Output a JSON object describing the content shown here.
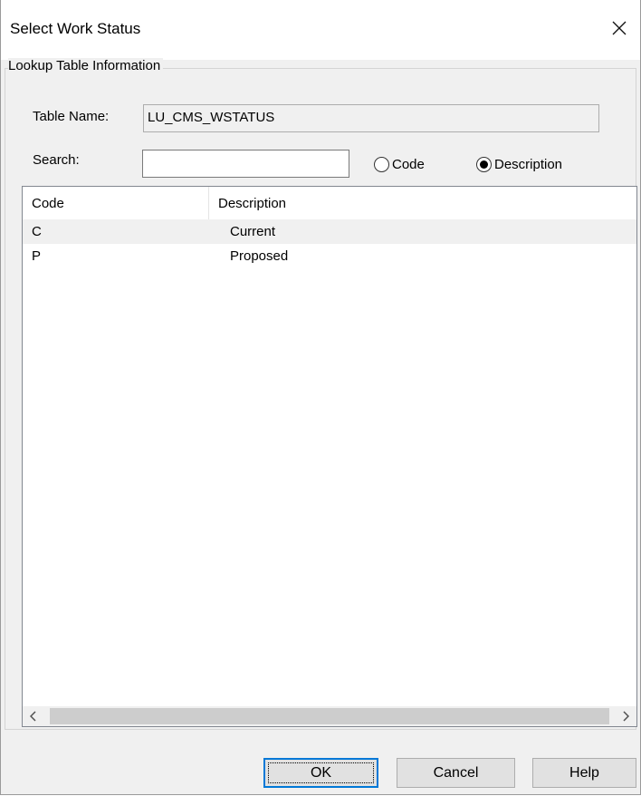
{
  "window": {
    "title": "Select Work Status"
  },
  "group": {
    "legend": "Lookup Table Information"
  },
  "table_name": {
    "label": "Table Name:",
    "value": "LU_CMS_WSTATUS"
  },
  "search": {
    "label": "Search:",
    "value": "",
    "placeholder": ""
  },
  "search_mode": {
    "options": [
      {
        "label": "Code",
        "selected": false
      },
      {
        "label": "Description",
        "selected": true
      }
    ]
  },
  "list": {
    "columns": [
      "Code",
      "Description"
    ],
    "rows": [
      {
        "code": "C",
        "description": "Current",
        "selected": true
      },
      {
        "code": "P",
        "description": "Proposed",
        "selected": false
      }
    ]
  },
  "buttons": {
    "ok": "OK",
    "cancel": "Cancel",
    "help": "Help"
  },
  "icons": {
    "close": "close-icon",
    "scroll_left": "chevron-left-icon",
    "scroll_right": "chevron-right-icon"
  }
}
